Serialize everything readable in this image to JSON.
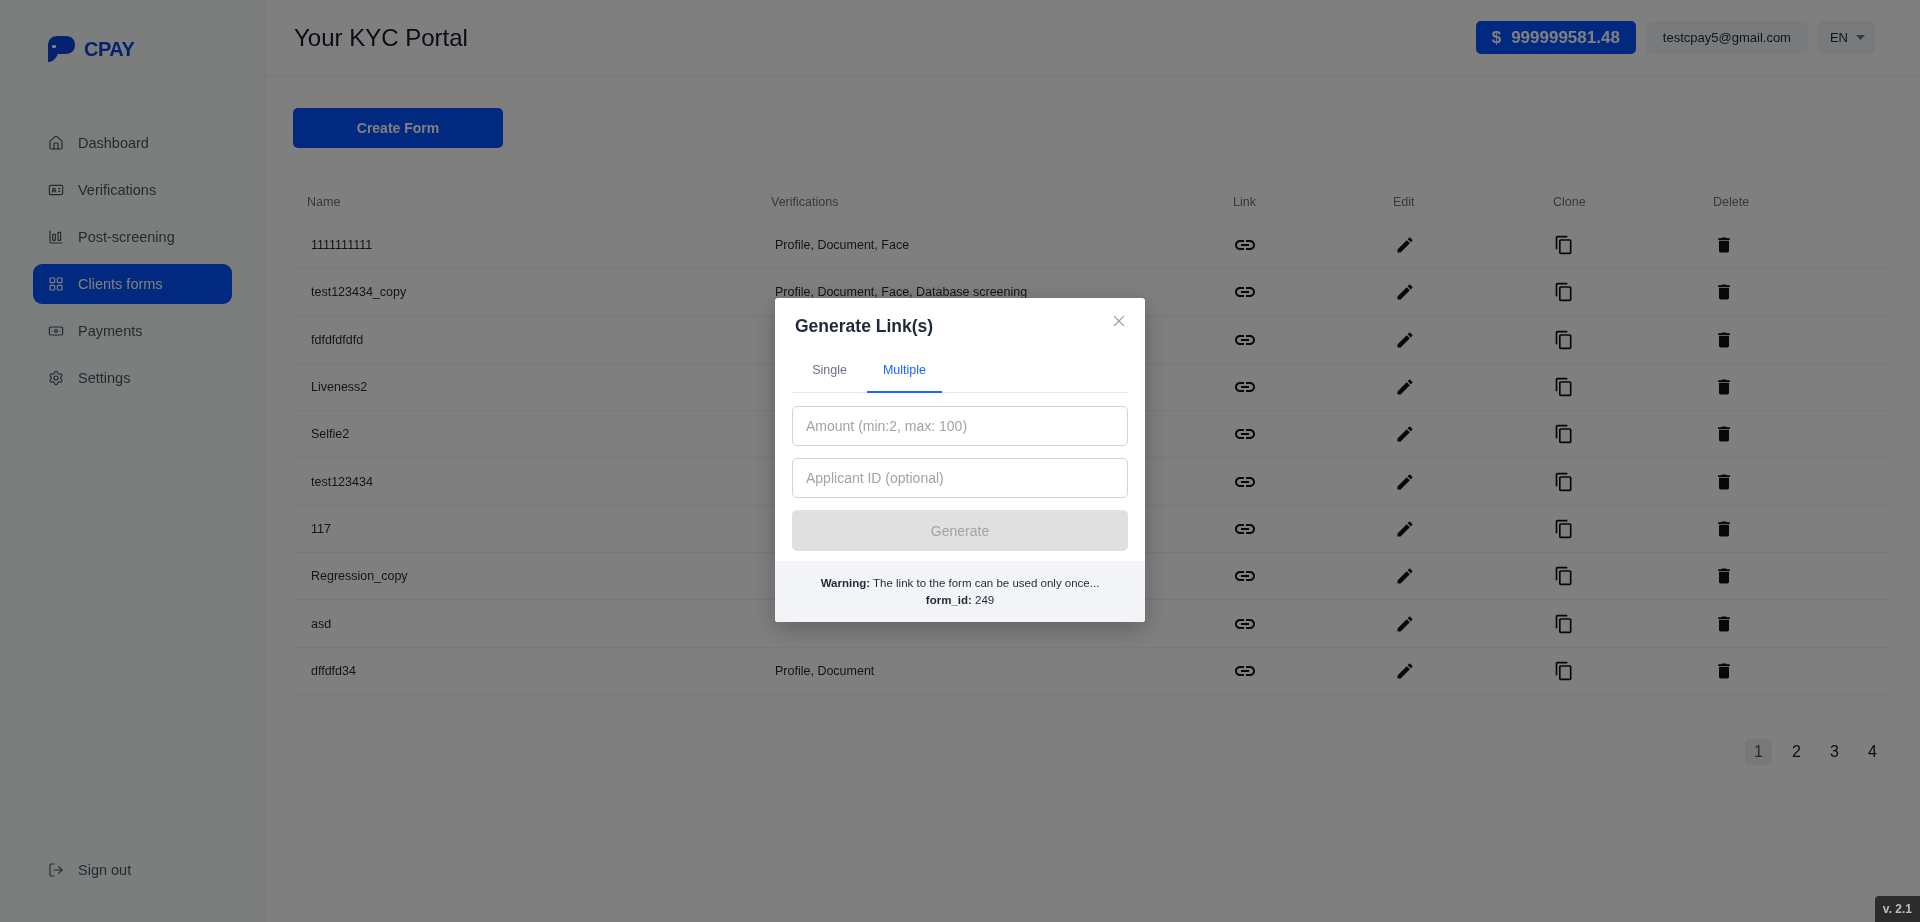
{
  "brand": {
    "name": "CPAY"
  },
  "sidebar": {
    "items": [
      {
        "label": "Dashboard",
        "selected": false
      },
      {
        "label": "Verifications",
        "selected": false
      },
      {
        "label": "Post-screening",
        "selected": false
      },
      {
        "label": "Clients forms",
        "selected": true
      },
      {
        "label": "Payments",
        "selected": false
      },
      {
        "label": "Settings",
        "selected": false
      }
    ],
    "footer_item": {
      "label": "Sign out"
    }
  },
  "header": {
    "title": "Your KYC Portal",
    "balance": {
      "currency": "$",
      "amount": "999999581.48"
    },
    "email": "testcpay5@gmail.com",
    "language": "EN"
  },
  "create_button": "Create Form",
  "table": {
    "columns": [
      "Name",
      "Verifications",
      "Link",
      "Edit",
      "Clone",
      "Delete"
    ],
    "rows": [
      {
        "name": "1111111111",
        "verifications": "Profile, Document, Face"
      },
      {
        "name": "test123434_copy",
        "verifications": "Profile, Document, Face, Database screening"
      },
      {
        "name": "fdfdfdfdfd"
      },
      {
        "name": "Liveness2"
      },
      {
        "name": "Selfie2"
      },
      {
        "name": "test123434"
      },
      {
        "name": "117"
      },
      {
        "name": "Regression_copy"
      },
      {
        "name": "asd"
      },
      {
        "name": "dffdfd34",
        "verifications": "Profile, Document"
      }
    ]
  },
  "pagination": [
    {
      "label": "1",
      "selected": true
    },
    {
      "label": "2",
      "selected": false
    },
    {
      "label": "3",
      "selected": false
    },
    {
      "label": "4",
      "selected": false
    }
  ],
  "version": "v. 2.1",
  "modal": {
    "title": "Generate Link(s)",
    "tabs": [
      {
        "label": "Single",
        "selected": false
      },
      {
        "label": "Multiple",
        "selected": true
      }
    ],
    "fields": [
      {
        "placeholder": "Amount (min:2, max: 100)"
      },
      {
        "placeholder": "Applicant ID (optional)"
      }
    ],
    "submit": {
      "label": "Generate",
      "disabled": true
    },
    "warning": "**Warning:** The link to the form can be used only once...",
    "form_id": "**form_id:** 249"
  }
}
